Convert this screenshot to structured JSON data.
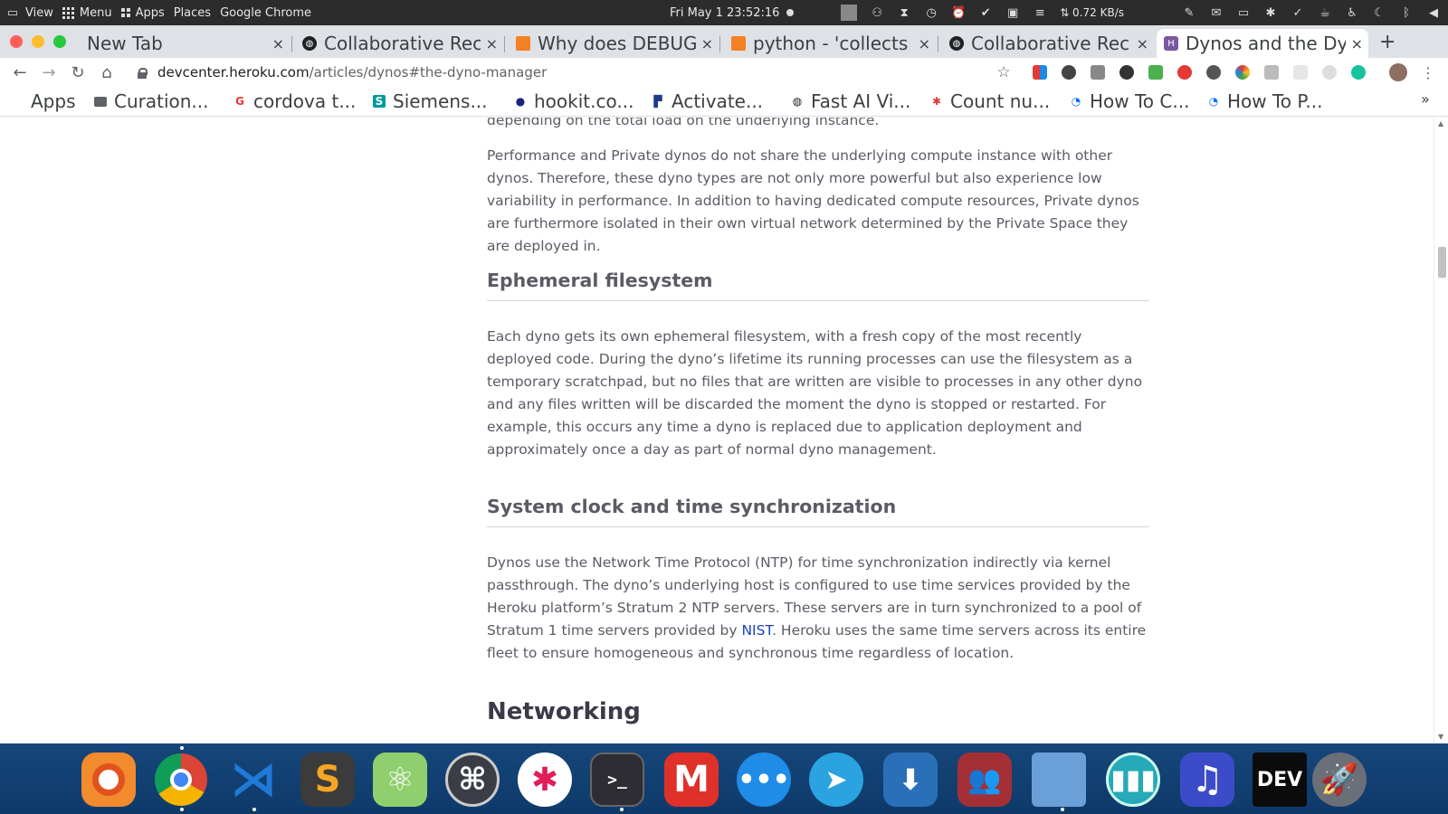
{
  "system_panel": {
    "view_label": "View",
    "menu_label": "Menu",
    "apps_label": "Apps",
    "places_label": "Places",
    "active_app": "Google Chrome",
    "clock": "Fri May 1  23:52:16",
    "net_speed": "⇅ 0.72 KB/s"
  },
  "tabs": [
    {
      "title": "New Tab",
      "favicon_icon": "none",
      "active": false
    },
    {
      "title": "Collaborative Rec",
      "favicon_icon": "globe-icon",
      "active": false
    },
    {
      "title": "Why does DEBUG",
      "favicon_icon": "stackoverflow-icon",
      "active": false
    },
    {
      "title": "python - 'collects",
      "favicon_icon": "stackoverflow-icon",
      "active": false
    },
    {
      "title": "Collaborative Rec",
      "favicon_icon": "globe-icon",
      "active": false
    },
    {
      "title": "Dynos and the Dy",
      "favicon_icon": "heroku-icon",
      "active": true
    }
  ],
  "new_tab_label": "+",
  "close_glyph": "×",
  "address_bar": {
    "host": "devcenter.heroku.com",
    "path": "/articles/dynos#the-dyno-manager"
  },
  "bookmarks": [
    {
      "label": "Apps",
      "icon": "apps-grid-icon"
    },
    {
      "label": "Curation...",
      "icon": "folder-icon"
    },
    {
      "label": "cordova t...",
      "icon": "google-icon"
    },
    {
      "label": "Siemens...",
      "icon": "s-icon"
    },
    {
      "label": "hookit.co...",
      "icon": "dot-icon"
    },
    {
      "label": "Activate...",
      "icon": "activate-icon"
    },
    {
      "label": "Fast AI Vi...",
      "icon": "globe-icon"
    },
    {
      "label": "Count nu...",
      "icon": "bug-icon"
    },
    {
      "label": "How To C...",
      "icon": "digitalocean-icon"
    },
    {
      "label": "How To P...",
      "icon": "digitalocean-icon"
    }
  ],
  "bookmarks_more": "»",
  "article": {
    "cut_line": "depending on the total load on the underlying instance.",
    "perf_paragraph": "Performance and Private dynos do not share the underlying compute instance with other dynos. Therefore, these dyno types are not only more powerful but also experience low variability in performance. In addition to having dedicated compute resources, Private dynos are furthermore isolated in their own virtual network determined by the Private Space they are deployed in.",
    "ephemeral_heading": "Ephemeral filesystem",
    "ephemeral_paragraph": "Each dyno gets its own ephemeral filesystem, with a fresh copy of the most recently deployed code. During the dyno’s lifetime its running processes can use the filesystem as a temporary scratchpad, but no files that are written are visible to processes in any other dyno and any files written will be discarded the moment the dyno is stopped or restarted. For example, this occurs any time a dyno is replaced due to application deployment and approximately once a day as part of normal dyno management.",
    "clock_heading": "System clock and time synchronization",
    "clock_paragraph_before": "Dynos use the Network Time Protocol (NTP) for time synchronization indirectly via kernel passthrough. The dyno’s underlying host is configured to use time services provided by the Heroku platform’s Stratum 2 NTP servers. These servers are in turn synchronized to a pool of Stratum 1 time servers provided by ",
    "clock_link": "NIST",
    "clock_paragraph_after": ". Heroku uses the same time servers across its entire fleet to ensure homogeneous and synchronous time regardless of location.",
    "networking_heading": "Networking"
  },
  "dock": [
    {
      "name": "firefox-icon",
      "color": "#f28a2e"
    },
    {
      "name": "chrome-icon",
      "color": "#e0463a"
    },
    {
      "name": "vscode-icon",
      "color": "#1f7ad8"
    },
    {
      "name": "sublime-text-icon",
      "color": "#3b3b3b"
    },
    {
      "name": "atom-icon",
      "color": "#8fcf6d"
    },
    {
      "name": "gitkraken-icon",
      "color": "#3a3d46"
    },
    {
      "name": "slack-icon",
      "color": "#ffffff"
    },
    {
      "name": "terminal-icon",
      "color": "#2d2d33"
    },
    {
      "name": "gmail-icon",
      "color": "#e0302a"
    },
    {
      "name": "messages-icon",
      "color": "#1f8ce8"
    },
    {
      "name": "telegram-icon",
      "color": "#2aa3e0"
    },
    {
      "name": "software-center-icon",
      "color": "#2a70b8"
    },
    {
      "name": "contacts-icon",
      "color": "#a42f35"
    },
    {
      "name": "files-icon",
      "color": "#6a9fd8"
    },
    {
      "name": "stats-icon",
      "color": "#26a9b8"
    },
    {
      "name": "music-icon",
      "color": "#3c4cc8"
    },
    {
      "name": "dev-to-icon",
      "color": "#0b0b0b"
    },
    {
      "name": "launcher-icon",
      "color": "#6b6f78"
    }
  ],
  "dock_labels": {
    "sublime": "S",
    "gmail": "M",
    "dev": "DEV",
    "terminal": ">_",
    "music": "♫"
  }
}
